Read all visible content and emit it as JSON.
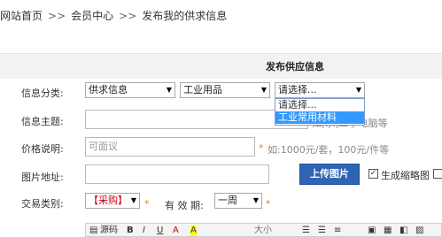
{
  "breadcrumb": {
    "items": [
      "网站首页",
      "会员中心",
      "发布我的供求信息"
    ],
    "separator": ">>"
  },
  "panel": {
    "title": "发布供应信息"
  },
  "form": {
    "category_label": "信息分类:",
    "category_select_1": "供求信息",
    "category_select_2": "工业用品",
    "category_select_3": "请选择...",
    "category_dropdown_options": [
      "请选择...",
      "工业常用材料"
    ],
    "category_dropdown_selected": "工业常用材料",
    "subject_label": "信息主题:",
    "subject_hint": "如[求]二手电脑等",
    "price_label": "价格说明:",
    "price_placeholder": "可面议",
    "price_hint": "如:1000元/套，100元/件等",
    "image_label": "图片地址:",
    "upload_button": "上传图片",
    "thumbnail_label": "生成缩略图",
    "thumbnail_checked": true,
    "trade_label": "交易类别:",
    "trade_value": "【采购】",
    "validity_label": "有 效 期:",
    "validity_value": "一周",
    "star": "*"
  },
  "editor": {
    "source_label": "源码",
    "bold": "B",
    "italic": "I",
    "underline": "U",
    "font_color": "A",
    "highlight": "A",
    "font_size": "大小"
  },
  "colors": {
    "accent": "#2f64b4",
    "required": "#e87a1b",
    "trade_text": "#d0021b"
  }
}
